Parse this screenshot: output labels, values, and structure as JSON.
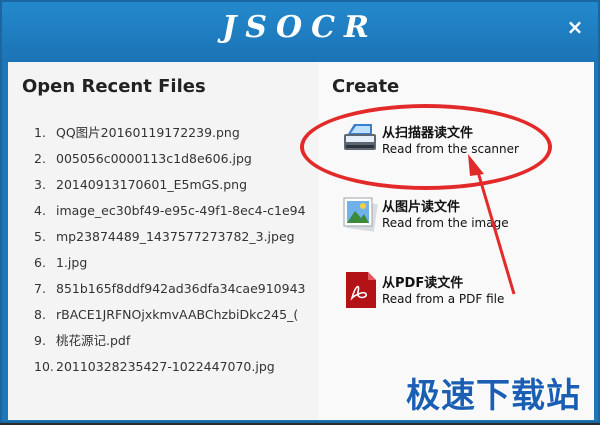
{
  "window": {
    "title": "JSOCR",
    "close_glyph": "×"
  },
  "recent": {
    "heading": "Open Recent Files",
    "files": [
      {
        "num": "1.",
        "name": "QQ图片20160119172239.png"
      },
      {
        "num": "2.",
        "name": "005056c0000113c1d8e606.jpg"
      },
      {
        "num": "3.",
        "name": "20140913170601_E5mGS.png"
      },
      {
        "num": "4.",
        "name": "image_ec30bf49-e95c-49f1-8ec4-c1e94"
      },
      {
        "num": "5.",
        "name": "mp23874489_1437577273782_3.jpeg"
      },
      {
        "num": "6.",
        "name": "1.jpg"
      },
      {
        "num": "7.",
        "name": "851b165f8ddf942ad36dfa34cae910943"
      },
      {
        "num": "8.",
        "name": "rBACE1JRFNOjxkmvAABChzbiDkc245_("
      },
      {
        "num": "9.",
        "name": "桃花源记.pdf"
      },
      {
        "num": "10.",
        "name": "20110328235427-1022447070.jpg"
      }
    ]
  },
  "create": {
    "heading": "Create",
    "items": [
      {
        "cn": "从扫描器读文件",
        "en": "Read from the scanner",
        "icon": "scanner-icon"
      },
      {
        "cn": "从图片读文件",
        "en": "Read from the image",
        "icon": "image-icon"
      },
      {
        "cn": "从PDF读文件",
        "en": "Read from a PDF file",
        "icon": "pdf-icon"
      }
    ]
  },
  "watermark": "极速下载站",
  "colors": {
    "titlebar": "#1e77b8",
    "highlight": "#e32a2a",
    "watermark": "#1a5fb4"
  }
}
